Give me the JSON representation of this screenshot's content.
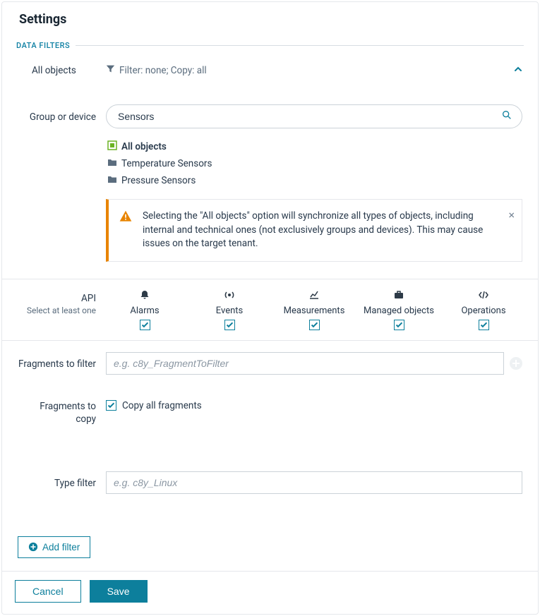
{
  "header": {
    "title": "Settings"
  },
  "section": {
    "label": "DATA FILTERS"
  },
  "summary": {
    "objects": "All objects",
    "filter_text": "Filter: none; Copy: all"
  },
  "group_device": {
    "label": "Group or device",
    "search_value": "Sensors",
    "tree": [
      {
        "label": "All objects",
        "bold": true,
        "icon": "allobjects"
      },
      {
        "label": "Temperature Sensors",
        "bold": false,
        "icon": "folder"
      },
      {
        "label": "Pressure Sensors",
        "bold": false,
        "icon": "folder"
      }
    ],
    "warning": "Selecting the \"All objects\" option will synchronize all types of objects, including internal and technical ones (not exclusively groups and devices). This may cause issues on the target tenant."
  },
  "api": {
    "label": "API",
    "sublabel": "Select at least one",
    "items": [
      {
        "label": "Alarms",
        "icon": "bell",
        "checked": true
      },
      {
        "label": "Events",
        "icon": "broadcast",
        "checked": true
      },
      {
        "label": "Measurements",
        "icon": "chart",
        "checked": true
      },
      {
        "label": "Managed objects",
        "icon": "briefcase",
        "checked": true
      },
      {
        "label": "Operations",
        "icon": "code",
        "checked": true
      }
    ]
  },
  "fragments_filter": {
    "label": "Fragments to filter",
    "placeholder": "e.g. c8y_FragmentToFilter"
  },
  "fragments_copy": {
    "label": "Fragments to copy",
    "checkbox_label": "Copy all fragments",
    "checked": true
  },
  "type_filter": {
    "label": "Type filter",
    "placeholder": "e.g. c8y_Linux"
  },
  "actions": {
    "add_filter": "Add filter",
    "cancel": "Cancel",
    "save": "Save"
  }
}
